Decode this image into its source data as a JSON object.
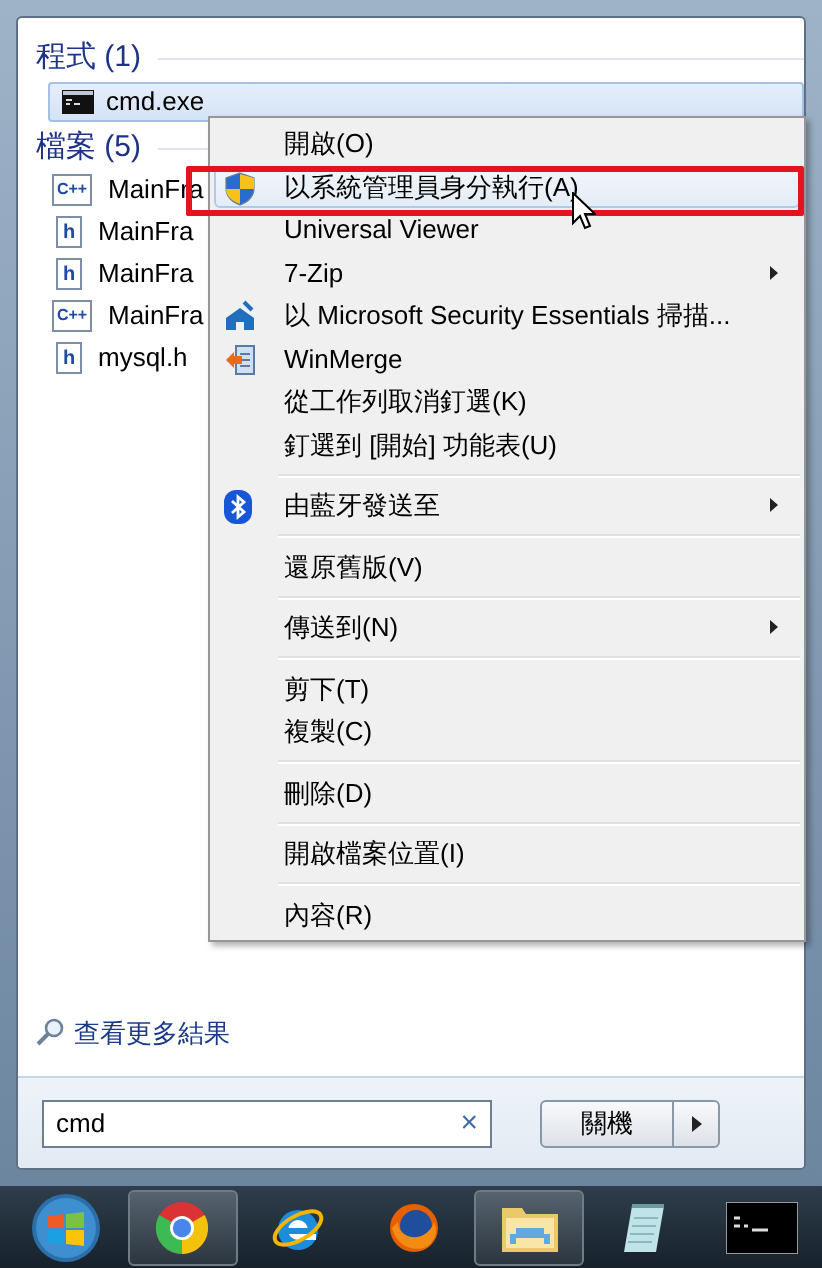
{
  "programs": {
    "header": "程式 (1)",
    "items": [
      {
        "label": "cmd.exe",
        "selected": true
      }
    ]
  },
  "files": {
    "header": "檔案 (5)",
    "items": [
      {
        "label": "MainFra",
        "kind": "cpp",
        "icon_text": "C++"
      },
      {
        "label": "MainFra",
        "kind": "header",
        "icon_text": "h"
      },
      {
        "label": "MainFra",
        "kind": "header",
        "icon_text": "h"
      },
      {
        "label": "MainFra",
        "kind": "cpp",
        "icon_text": "C++"
      },
      {
        "label": "mysql.h",
        "kind": "header",
        "icon_text": "h"
      }
    ]
  },
  "context_menu": [
    {
      "kind": "item",
      "label": "開啟(O)",
      "selected": false
    },
    {
      "kind": "shield",
      "label": "以系統管理員身分執行(A)",
      "selected": true
    },
    {
      "kind": "item",
      "label": "Universal Viewer",
      "selected": false
    },
    {
      "kind": "item",
      "label": "7-Zip",
      "selected": false,
      "submenu": true
    },
    {
      "kind": "scan",
      "label": "以 Microsoft Security Essentials 掃描...",
      "selected": false
    },
    {
      "kind": "merge",
      "label": "WinMerge",
      "selected": false
    },
    {
      "kind": "item",
      "label": "從工作列取消釘選(K)",
      "selected": false
    },
    {
      "kind": "item",
      "label": "釘選到 [開始] 功能表(U)",
      "selected": false
    },
    {
      "kind": "separator"
    },
    {
      "kind": "bluetooth",
      "label": "由藍牙發送至",
      "selected": false,
      "submenu": true
    },
    {
      "kind": "separator"
    },
    {
      "kind": "item",
      "label": "還原舊版(V)",
      "selected": false
    },
    {
      "kind": "separator"
    },
    {
      "kind": "item",
      "label": "傳送到(N)",
      "selected": false,
      "submenu": true
    },
    {
      "kind": "separator"
    },
    {
      "kind": "item",
      "label": "剪下(T)",
      "selected": false
    },
    {
      "kind": "item",
      "label": "複製(C)",
      "selected": false
    },
    {
      "kind": "separator"
    },
    {
      "kind": "item",
      "label": "刪除(D)",
      "selected": false
    },
    {
      "kind": "separator"
    },
    {
      "kind": "item",
      "label": "開啟檔案位置(I)",
      "selected": false
    },
    {
      "kind": "separator"
    },
    {
      "kind": "item",
      "label": "內容(R)",
      "selected": false
    }
  ],
  "more_results": "查看更多結果",
  "search": {
    "value": "cmd",
    "clear": "×"
  },
  "shutdown": {
    "label": "關機"
  },
  "taskbar": [
    {
      "kind": "start",
      "running": false
    },
    {
      "kind": "chrome",
      "running": true
    },
    {
      "kind": "ie",
      "running": false
    },
    {
      "kind": "firefox",
      "running": false
    },
    {
      "kind": "folder",
      "running": true
    },
    {
      "kind": "notepad",
      "running": false
    },
    {
      "kind": "console",
      "running": false
    }
  ]
}
